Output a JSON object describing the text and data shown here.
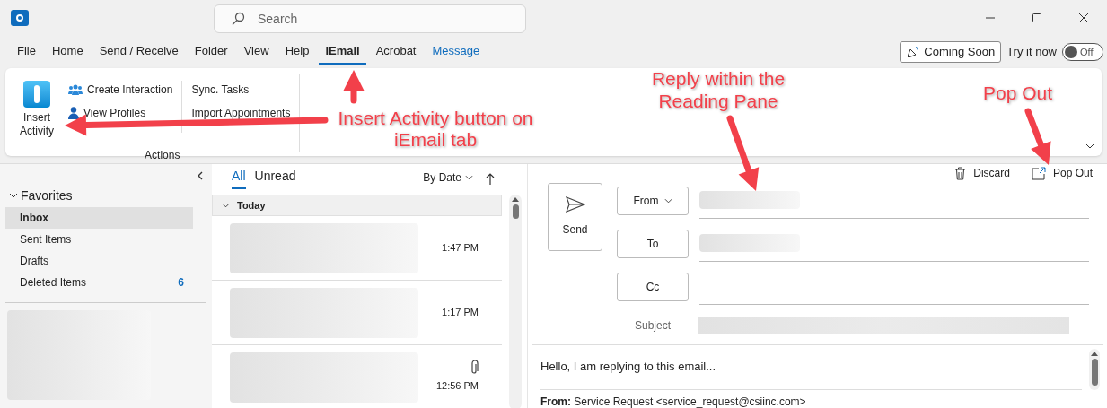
{
  "search": {
    "placeholder": "Search"
  },
  "menu_tabs": [
    {
      "label": "File",
      "selected": false,
      "kind": "plain"
    },
    {
      "label": "Home",
      "selected": false,
      "kind": "plain"
    },
    {
      "label": "Send / Receive",
      "selected": false,
      "kind": "plain"
    },
    {
      "label": "Folder",
      "selected": false,
      "kind": "plain"
    },
    {
      "label": "View",
      "selected": false,
      "kind": "plain"
    },
    {
      "label": "Help",
      "selected": false,
      "kind": "plain"
    },
    {
      "label": "iEmail",
      "selected": true,
      "kind": "plain"
    },
    {
      "label": "Acrobat",
      "selected": false,
      "kind": "plain"
    },
    {
      "label": "Message",
      "selected": false,
      "kind": "contextual"
    }
  ],
  "coming_soon": {
    "label": "Coming Soon",
    "try_label": "Try it now",
    "toggle_label": "Off",
    "on": false
  },
  "ribbon": {
    "large_button": "Insert Activity",
    "small_buttons": [
      {
        "label": "Create Interaction",
        "kind": "people"
      },
      {
        "label": "View Profiles",
        "kind": "person"
      }
    ],
    "text_buttons": [
      "Sync. Tasks",
      "Import Appointments"
    ],
    "group_label": "Actions"
  },
  "sidebar": {
    "section": "Favorites",
    "items": [
      {
        "label": "Inbox",
        "selected": true
      },
      {
        "label": "Sent Items",
        "selected": false
      },
      {
        "label": "Drafts",
        "selected": false
      },
      {
        "label": "Deleted Items",
        "selected": false,
        "count": "6"
      }
    ]
  },
  "message_list": {
    "filters": [
      {
        "label": "All",
        "selected": true
      },
      {
        "label": "Unread",
        "selected": false
      }
    ],
    "sort": "By Date",
    "group": "Today",
    "messages": [
      {
        "time": "1:47 PM",
        "attachment": false
      },
      {
        "time": "1:17 PM",
        "attachment": false
      },
      {
        "time": "12:56 PM",
        "attachment": true
      }
    ]
  },
  "reading_pane": {
    "actions": [
      {
        "label": "Discard",
        "kind": "trash"
      },
      {
        "label": "Pop Out",
        "kind": "popout"
      }
    ],
    "send": "Send",
    "fields": [
      {
        "label": "From",
        "kind": "dropdown"
      },
      {
        "label": "To",
        "kind": "plain"
      },
      {
        "label": "Cc",
        "kind": "plain"
      }
    ],
    "subject_label": "Subject",
    "body": "Hello, I am replying to this email...",
    "quoted_header": "**From:** Service Request <service_request@csiinc.com>"
  },
  "annotations": [
    "Insert Activity button on iEmail tab",
    "Reply within the Reading Pane",
    "Pop Out"
  ]
}
